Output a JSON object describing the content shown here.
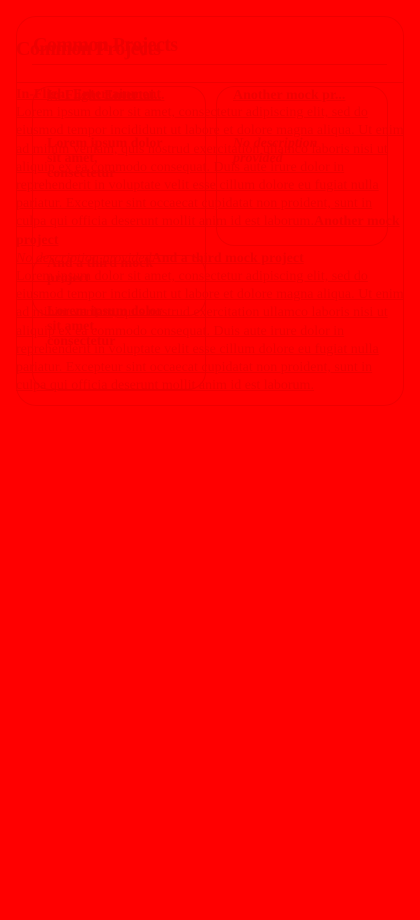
{
  "section": {
    "title": "Common Projects"
  },
  "projects": [
    {
      "title": "In-Flight Entertainment",
      "title_short": "In-Flight Entertai...",
      "description": "Lorem ipsum dolor sit amet, consectetur adipiscing elit, sed do eiusmod tempor incididunt ut labore et dolore magna aliqua. Ut enim ad minim veniam, quis nostrud exercitation ullamco laboris nisi ut aliquip ex ea commodo consequat. Duis aute irure dolor in reprehenderit in voluptate velit esse cillum dolore eu fugiat nulla pariatur. Excepteur sint occaecat cupidatat non proident, sunt in culpa qui officia deserunt mollit anim id est laborum.",
      "desc_line1": "Lorem ipsum dolor",
      "desc_line2": "sit amet,",
      "desc_line3": "consectetur"
    },
    {
      "title": "Another mock project",
      "title_short": "Another mock pr...",
      "description": "No description provided",
      "desc_line1": "No description",
      "desc_line2": "provided"
    },
    {
      "title": "And a third mock project",
      "title_short": "And a third mock",
      "title_line2": "project",
      "description": "Lorem ipsum dolor sit amet, consectetur adipiscing elit, sed do eiusmod tempor incididunt ut labore et dolore magna aliqua. Ut enim ad minim veniam, quis nostrud exercitation ullamco laboris nisi ut aliquip ex ea commodo consequat. Duis aute irure dolor in reprehenderit in voluptate velit esse cillum dolore eu fugiat nulla pariatur. Excepteur sint occaecat cupidatat non proident, sunt in culpa qui officia deserunt mollit anim id est laborum.",
      "desc_line1": "Lorem ipsum dolor",
      "desc_line2": "sit amet,",
      "desc_line3": "consectetur"
    }
  ],
  "colors": {
    "page_background": "#ff0000",
    "text": "#ee0000"
  }
}
